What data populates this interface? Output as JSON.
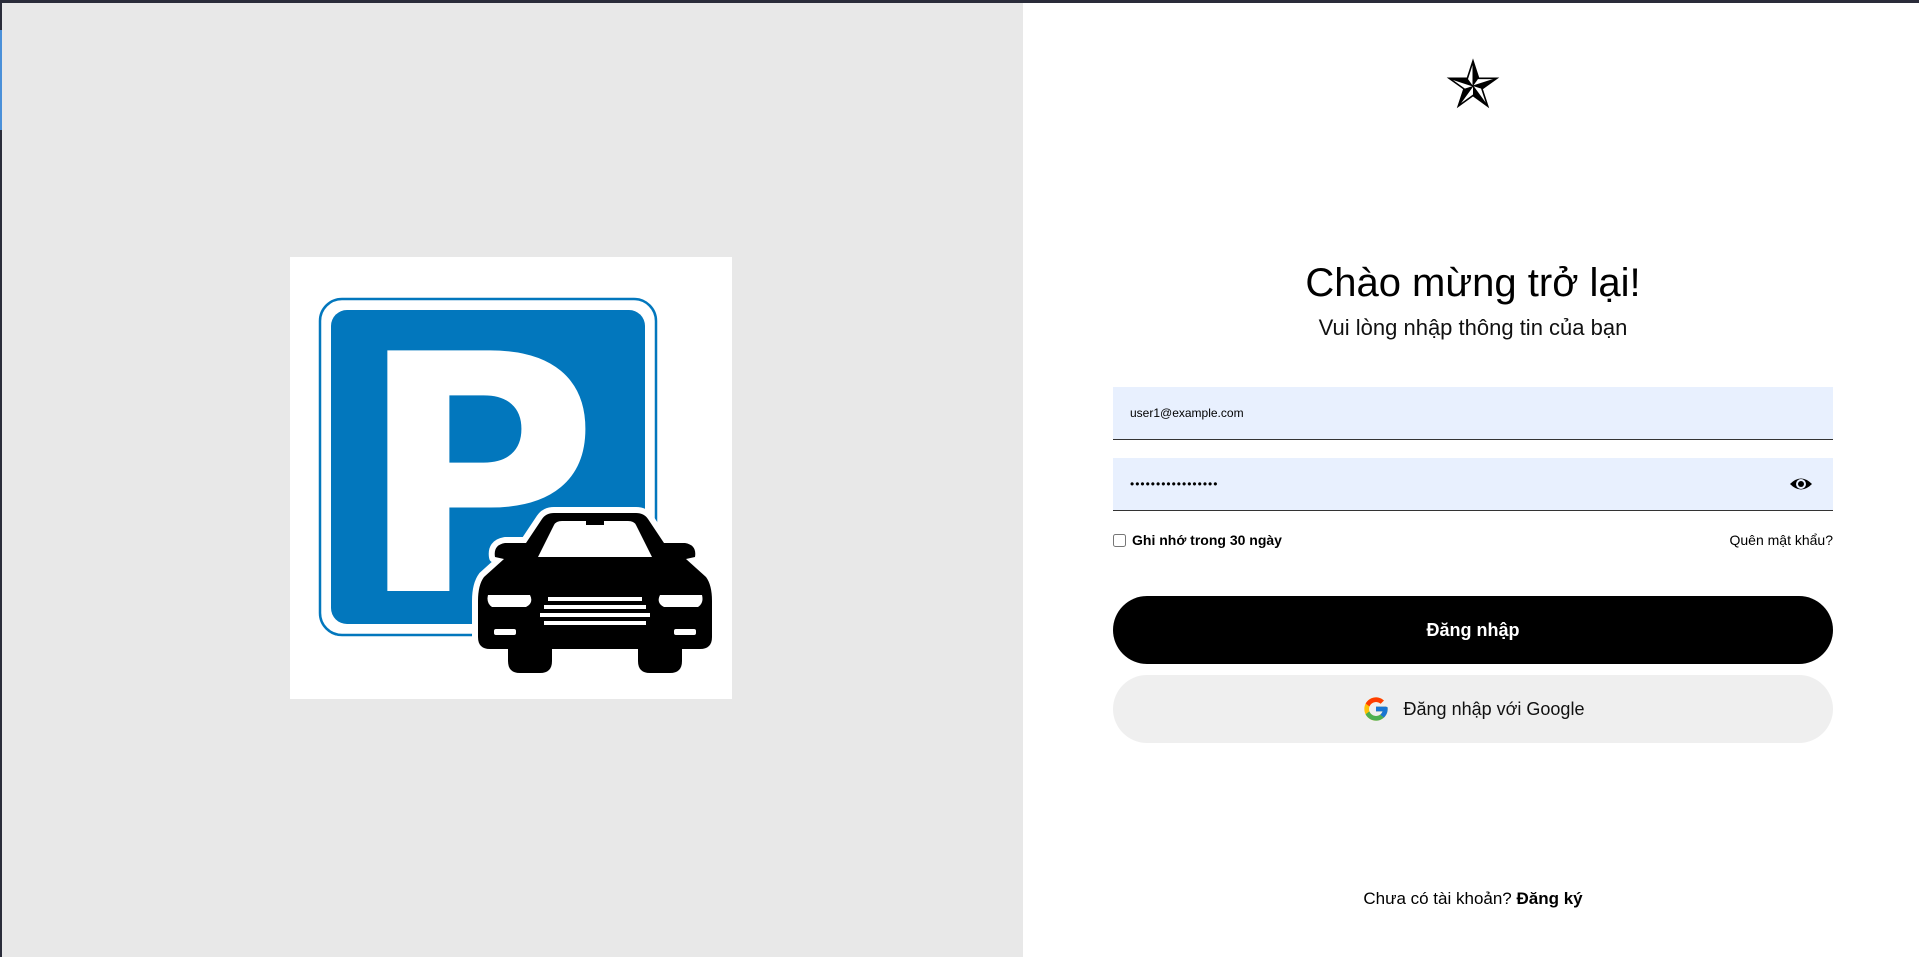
{
  "colors": {
    "left_panel_bg": "#e8e8e8",
    "parking_blue": "#0277bd",
    "input_bg": "#e8f0fe",
    "primary_button_bg": "#000000",
    "google_button_bg": "#efefef"
  },
  "illustration": {
    "sign_letter": "P"
  },
  "header": {
    "brand_icon": "nautical-star-icon",
    "title": "Chào mừng trở lại!",
    "subtitle": "Vui lòng nhập thông tin của bạn"
  },
  "form": {
    "email_value": "user1@example.com",
    "password_value": "abcdefghijklmnopq",
    "password_toggle_icon": "eye-icon",
    "remember_label": "Ghi nhớ trong 30 ngày",
    "remember_checked": false,
    "forgot_label": "Quên mật khẩu?",
    "login_label": "Đăng nhập",
    "google_label": "Đăng nhập với Google",
    "google_icon": "google-g-icon"
  },
  "footer": {
    "prompt": "Chưa có tài khoản?",
    "signup_label": "Đăng ký"
  }
}
